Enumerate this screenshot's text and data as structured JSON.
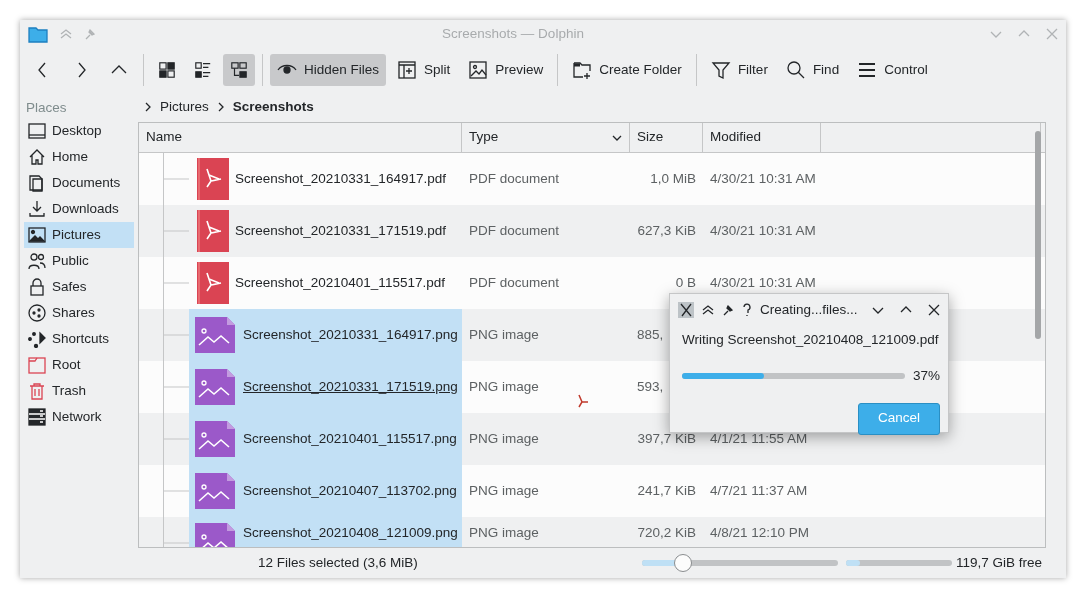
{
  "window": {
    "title": "Screenshots — Dolphin"
  },
  "view_modes": [
    {
      "selected": false
    },
    {
      "selected": false
    },
    {
      "selected": true
    }
  ],
  "toolbar_buttons": [
    {
      "label": "Hidden Files",
      "selected": true
    },
    {
      "label": "Split",
      "selected": false
    },
    {
      "label": "Preview",
      "selected": false
    },
    {
      "label": "Create Folder",
      "selected": false
    },
    {
      "label": "Filter",
      "selected": false
    },
    {
      "label": "Find",
      "selected": false
    },
    {
      "label": "Control",
      "selected": false
    }
  ],
  "places": {
    "title": "Places",
    "items": [
      {
        "label": "Desktop",
        "selected": false
      },
      {
        "label": "Home",
        "selected": false
      },
      {
        "label": "Documents",
        "selected": false
      },
      {
        "label": "Downloads",
        "selected": false
      },
      {
        "label": "Pictures",
        "selected": true
      },
      {
        "label": "Public",
        "selected": false
      },
      {
        "label": "Safes",
        "selected": false
      },
      {
        "label": "Shares",
        "selected": false
      },
      {
        "label": "Shortcuts",
        "selected": false
      },
      {
        "label": "Root",
        "selected": false
      },
      {
        "label": "Trash",
        "selected": false
      },
      {
        "label": "Network",
        "selected": false
      }
    ]
  },
  "breadcrumb": [
    {
      "label": "Pictures",
      "current": false
    },
    {
      "label": "Screenshots",
      "current": true
    }
  ],
  "table": {
    "columns": [
      "Name",
      "Type",
      "Size",
      "Modified"
    ],
    "rows": [
      {
        "kind": "pdf",
        "name": "Screenshot_20210331_164917.pdf",
        "type": "PDF document",
        "size": "1,0 MiB",
        "modified": "4/30/21 10:31 AM",
        "selected": false,
        "hovered": false
      },
      {
        "kind": "pdf",
        "name": "Screenshot_20210331_171519.pdf",
        "type": "PDF document",
        "size": "627,3 KiB",
        "modified": "4/30/21 10:31 AM",
        "selected": false,
        "hovered": false
      },
      {
        "kind": "pdf",
        "name": "Screenshot_20210401_115517.pdf",
        "type": "PDF document",
        "size": "0 B",
        "modified": "4/30/21 10:31 AM",
        "selected": false,
        "hovered": false
      },
      {
        "kind": "png",
        "name": "Screenshot_20210331_164917.png",
        "type": "PNG image",
        "size": "885,",
        "selected": true,
        "hovered": false
      },
      {
        "kind": "png",
        "name": "Screenshot_20210331_171519.png",
        "type": "PNG image",
        "size": "593,",
        "selected": true,
        "hovered": true
      },
      {
        "kind": "png",
        "name": "Screenshot_20210401_115517.png",
        "type": "PNG image",
        "size": "397,7 KiB",
        "modified": "4/1/21 11:55 AM",
        "selected": true,
        "hovered": false
      },
      {
        "kind": "png",
        "name": "Screenshot_20210407_113702.png",
        "type": "PNG image",
        "size": "241,7 KiB",
        "modified": "4/7/21 11:37 AM",
        "selected": true,
        "hovered": false
      },
      {
        "kind": "png",
        "name": "Screenshot_20210408_121009.png",
        "type": "PNG image",
        "size": "720,2 KiB",
        "modified": "4/8/21 12:10 PM",
        "selected": true,
        "hovered": false
      }
    ]
  },
  "progress_dialog": {
    "title": "Creating...files...",
    "message": "Writing Screenshot_20210408_121009.pdf",
    "level": 0.37,
    "percent": "37%",
    "button": "Cancel"
  },
  "status_bar": {
    "text": "12 Files selected (3,6 MiB)",
    "zoom": {
      "level": 0.21
    },
    "disk": {
      "level": 0.13
    },
    "free": "119,7 GiB free"
  }
}
